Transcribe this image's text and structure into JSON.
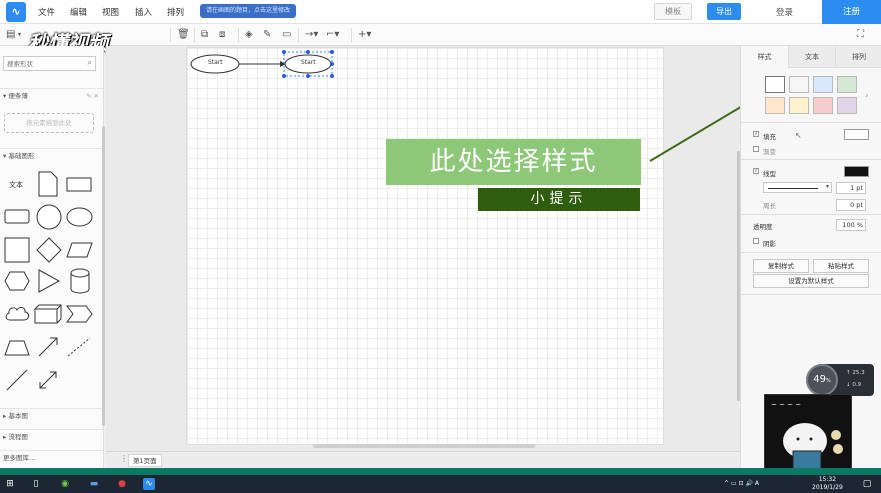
{
  "app": {
    "menu": [
      "文件",
      "编辑",
      "视图",
      "插入",
      "排列"
    ],
    "notice": "请在画图的题目，点击这里修改",
    "buttons": {
      "template": "模板",
      "export": "导出",
      "login": "登录",
      "register": "注册"
    },
    "watermark": "秒懂视频"
  },
  "sidebar": {
    "search_placeholder": "搜索形状",
    "scratchpad_title": "便条薄",
    "scratchpad_drop": "拖元素拖到此处",
    "basic_shapes_title": "基础图形",
    "text_shape_label": "文本",
    "more_sections": [
      "基本图",
      "流程图"
    ],
    "more_libraries": "更多图库..."
  },
  "canvas": {
    "node1_label": "Start",
    "node2_label": "Start",
    "page_tab": "第1页面"
  },
  "caption": {
    "main": "此处选择样式",
    "sub": "小提示"
  },
  "right_panel": {
    "tabs": [
      "样式",
      "文本",
      "排列"
    ],
    "swatches": [
      "#ffffff",
      "#f5f5f5",
      "#dae8fc",
      "#d5e8d4",
      "#ffe6cc",
      "#fff2cc",
      "#f8cecc",
      "#e1d5e7"
    ],
    "fill_label": "填充",
    "gradient_label": "渐变",
    "line_label": "线型",
    "line_width": "1 pt",
    "perimeter_label": "周长",
    "perimeter_value": "0 pt",
    "opacity_label": "透明度",
    "opacity_value": "100 %",
    "shadow_label": "阴影",
    "copy_style": "复制样式",
    "paste_style": "粘贴样式",
    "set_default": "设置为默认样式"
  },
  "widget": {
    "percent": "49",
    "upload": "25.3",
    "download": "0.9"
  },
  "taskbar": {
    "time": "15:32",
    "date": "2019/1/29",
    "ime": "A"
  },
  "colors": {
    "accent": "#2d8cf0",
    "caption_main_bg": "#8dc878",
    "caption_sub_bg": "#2e5e0c",
    "pointer_line": "#3e6b15"
  }
}
